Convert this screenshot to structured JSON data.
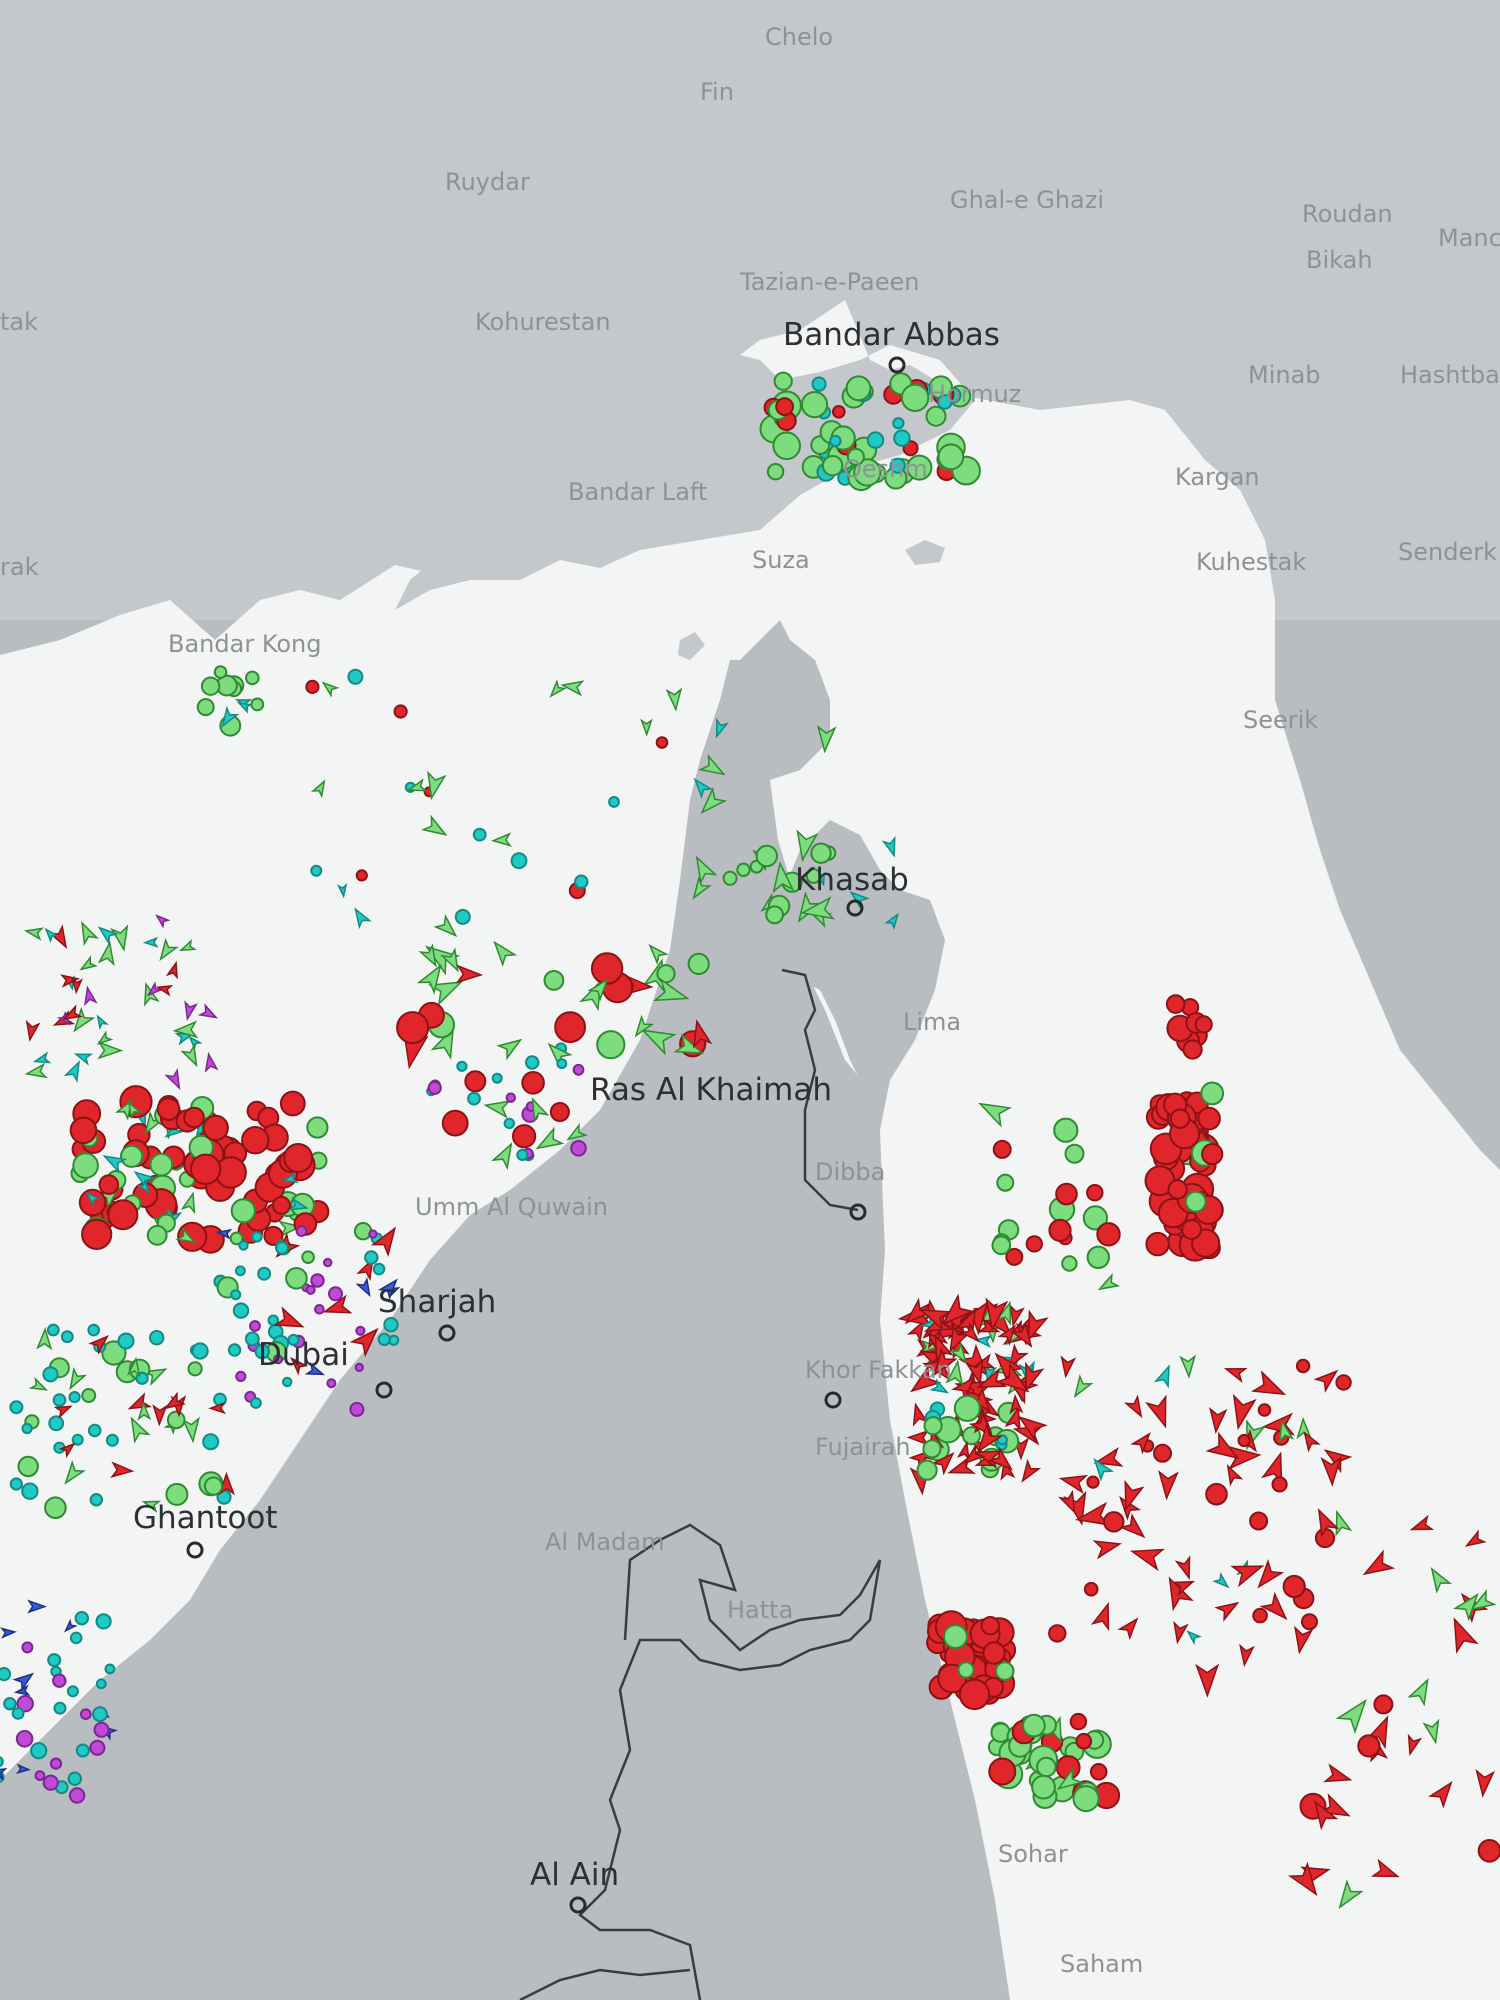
{
  "map": {
    "labels": [
      {
        "id": "chelo",
        "text": "Chelo",
        "kind": "minor"
      },
      {
        "id": "fin",
        "text": "Fin",
        "kind": "minor"
      },
      {
        "id": "ruydar",
        "text": "Ruydar",
        "kind": "minor"
      },
      {
        "id": "ghal-e-ghazi",
        "text": "Ghal-e Ghazi",
        "kind": "minor"
      },
      {
        "id": "roudan",
        "text": "Roudan",
        "kind": "minor"
      },
      {
        "id": "bikah",
        "text": "Bikah",
        "kind": "minor"
      },
      {
        "id": "mand",
        "text": "Manc",
        "kind": "minor"
      },
      {
        "id": "tazian",
        "text": "Tazian-e-Paeen",
        "kind": "minor"
      },
      {
        "id": "kohurestan",
        "text": "Kohurestan",
        "kind": "minor"
      },
      {
        "id": "tak",
        "text": "tak",
        "kind": "minor"
      },
      {
        "id": "bandar-abbas",
        "text": "Bandar Abbas",
        "kind": "major"
      },
      {
        "id": "hormuz",
        "text": "Hormuz",
        "kind": "minor"
      },
      {
        "id": "minab",
        "text": "Minab",
        "kind": "minor"
      },
      {
        "id": "hashtba",
        "text": "Hashtba",
        "kind": "minor"
      },
      {
        "id": "qeshm",
        "text": "Qeshm",
        "kind": "minor"
      },
      {
        "id": "bandar-laft",
        "text": "Bandar Laft",
        "kind": "minor"
      },
      {
        "id": "kargan",
        "text": "Kargan",
        "kind": "minor"
      },
      {
        "id": "rak",
        "text": "rak",
        "kind": "minor"
      },
      {
        "id": "suza",
        "text": "Suza",
        "kind": "minor"
      },
      {
        "id": "kuhestak",
        "text": "Kuhestak",
        "kind": "minor"
      },
      {
        "id": "senderk",
        "text": "Senderk",
        "kind": "minor"
      },
      {
        "id": "bandar-kong",
        "text": "Bandar Kong",
        "kind": "minor"
      },
      {
        "id": "seerik",
        "text": "Seerik",
        "kind": "minor"
      },
      {
        "id": "khasab",
        "text": "Khasab",
        "kind": "major"
      },
      {
        "id": "lima",
        "text": "Lima",
        "kind": "minor"
      },
      {
        "id": "ras-al-khaimah",
        "text": "Ras Al Khaimah",
        "kind": "major"
      },
      {
        "id": "dibba",
        "text": "Dibba",
        "kind": "minor"
      },
      {
        "id": "umm-al-quwain",
        "text": "Umm Al Quwain",
        "kind": "minor"
      },
      {
        "id": "sharjah",
        "text": "Sharjah",
        "kind": "major"
      },
      {
        "id": "dubai",
        "text": "Dubai",
        "kind": "major"
      },
      {
        "id": "khor-fakkan",
        "text": "Khor Fakkan",
        "kind": "minor"
      },
      {
        "id": "fujairah",
        "text": "Fujairah",
        "kind": "minor"
      },
      {
        "id": "ghantoot",
        "text": "Ghantoot",
        "kind": "major"
      },
      {
        "id": "al-madam",
        "text": "Al Madam",
        "kind": "minor"
      },
      {
        "id": "hatta",
        "text": "Hatta",
        "kind": "minor"
      },
      {
        "id": "sohar",
        "text": "Sohar",
        "kind": "minor"
      },
      {
        "id": "al-ain",
        "text": "Al Ain",
        "kind": "major"
      },
      {
        "id": "saham",
        "text": "Saham",
        "kind": "minor"
      }
    ],
    "colors": {
      "water": "#f3f4f4",
      "land": "#b9bcc0",
      "land_light": "#c9ccd0",
      "vessel_red": "#e0262b",
      "vessel_green": "#7ddc7e",
      "vessel_cyan": "#1fc9c4",
      "vessel_purple": "#c04ad6",
      "vessel_blue": "#3a5bd6"
    }
  }
}
